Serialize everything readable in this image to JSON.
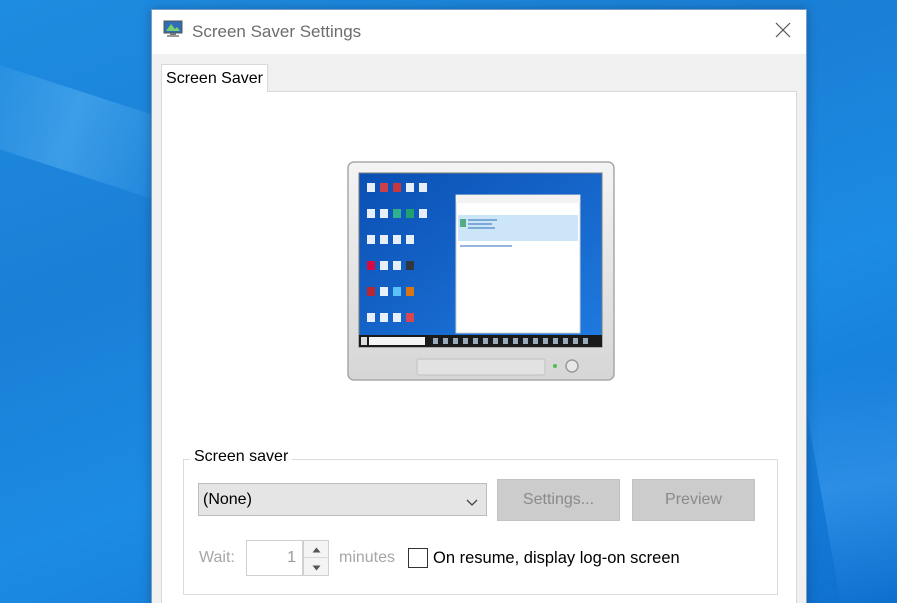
{
  "window": {
    "title": "Screen Saver Settings",
    "close_icon": "close-icon"
  },
  "tabs": [
    {
      "label": "Screen Saver",
      "selected": true
    }
  ],
  "preview_monitor": {
    "icon": "monitor-preview-image"
  },
  "screen_saver_group": {
    "label": "Screen saver",
    "selected_value": "(None)",
    "settings_button": "Settings...",
    "preview_button": "Preview",
    "wait_label": "Wait:",
    "wait_value": "1",
    "minutes_label": "minutes",
    "resume_checkbox_label": "On resume, display log-on screen",
    "resume_checked": false
  },
  "colors": {
    "desktop": "#1a7fd6",
    "dialog_bg": "#f0f0f0",
    "disabled_text": "#a6a6a6"
  }
}
